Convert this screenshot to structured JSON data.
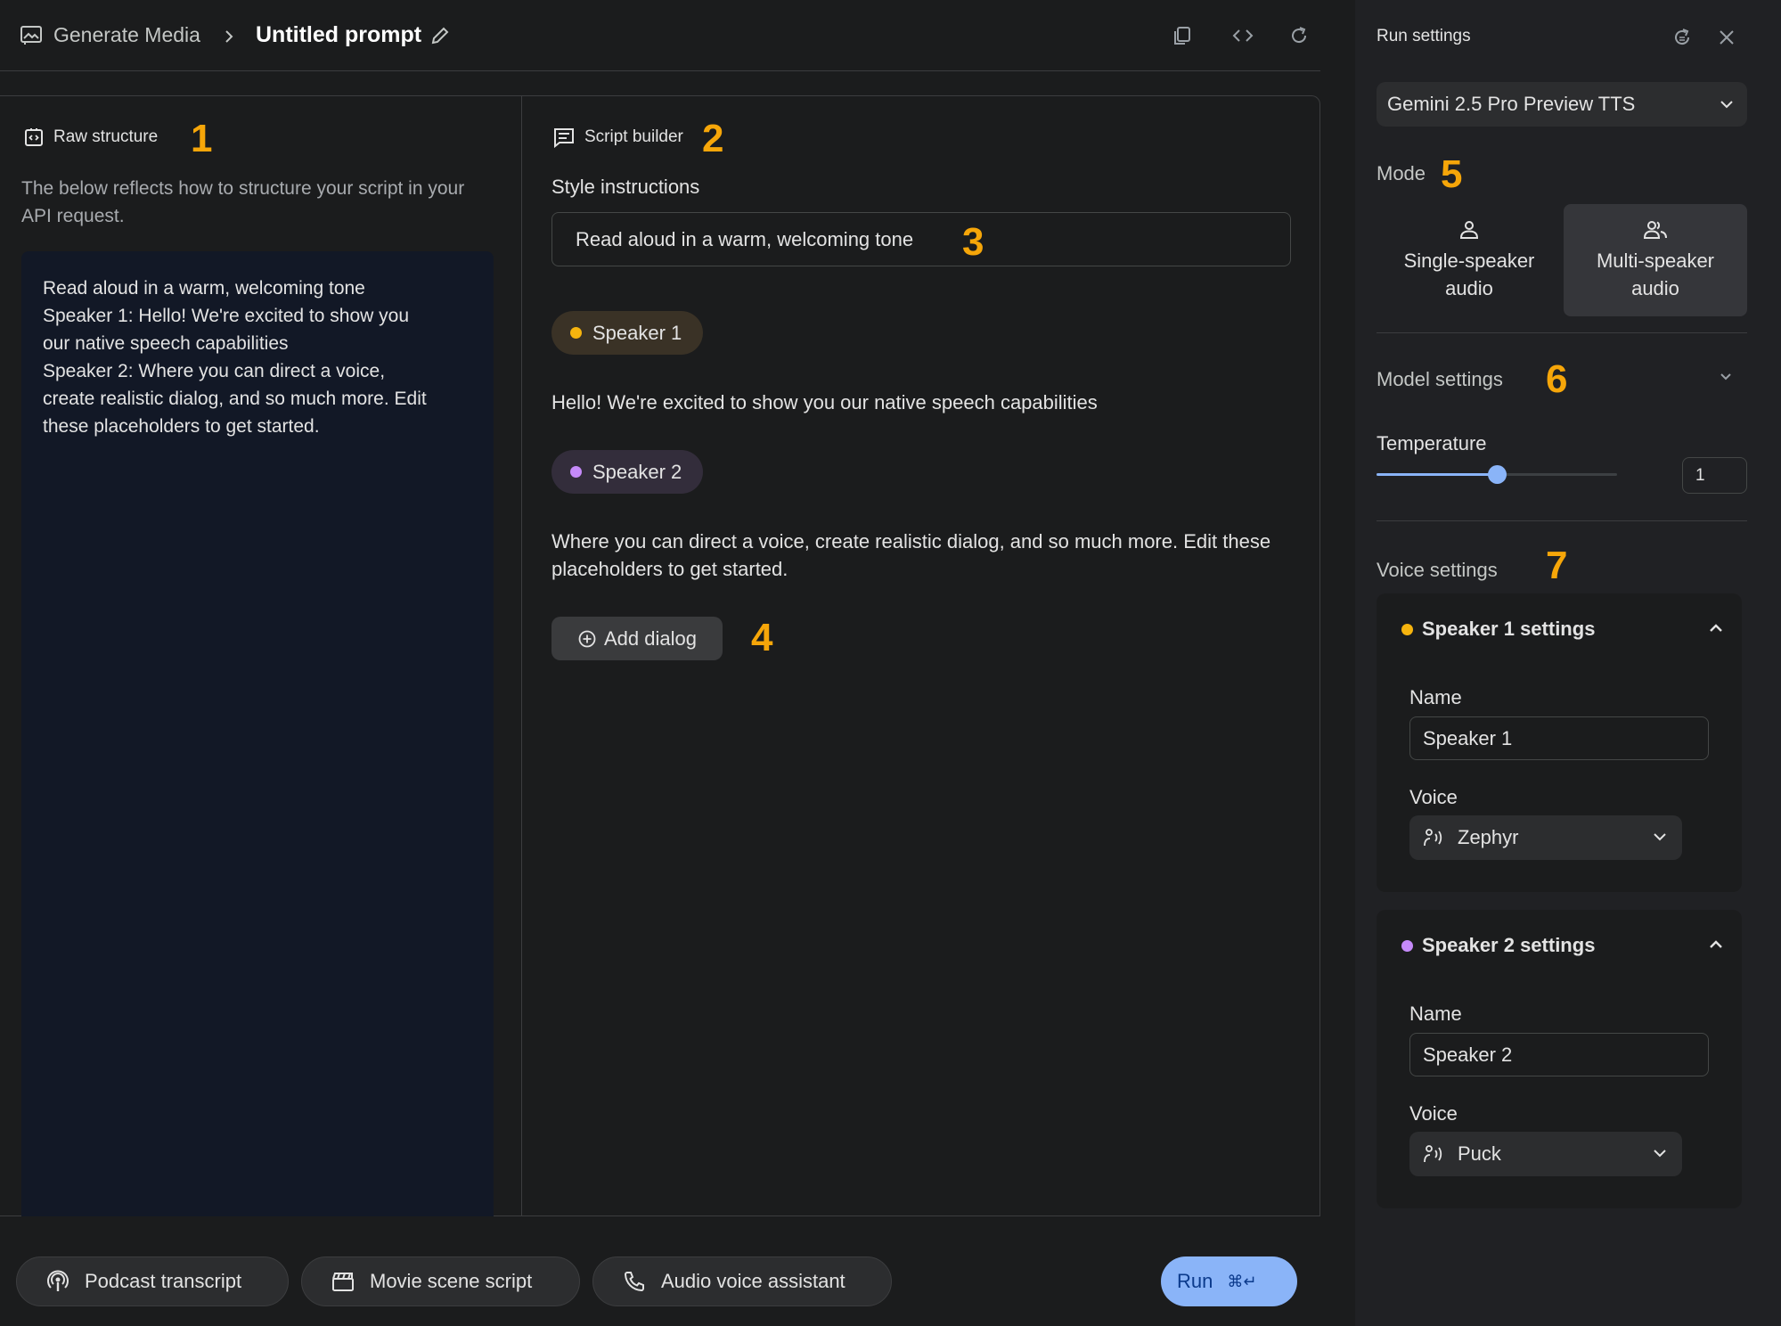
{
  "topbar": {
    "breadcrumb_root": "Generate Media",
    "breadcrumb_current": "Untitled prompt"
  },
  "raw": {
    "title": "Raw structure",
    "description": "The below reflects how to structure your script in your API request.",
    "lines": [
      "Read aloud in a warm, welcoming tone",
      "Speaker 1: Hello! We're excited to show you",
      "our native speech capabilities",
      "Speaker 2: Where you can direct a voice,",
      "create realistic dialog, and so much more. Edit",
      "these placeholders to get started."
    ]
  },
  "builder": {
    "title": "Script builder",
    "style_label": "Style instructions",
    "style_value": "Read aloud in a warm, welcoming tone",
    "speaker1_chip": "Speaker 1",
    "speaker1_text": "Hello! We're excited to show you our native speech capabilities",
    "speaker2_chip": "Speaker 2",
    "speaker2_text": "Where you can direct a voice, create realistic dialog, and so much more. Edit these placeholders to get started.",
    "add_dialog": "Add dialog"
  },
  "markers": [
    "1",
    "2",
    "3",
    "4",
    "5",
    "6",
    "7"
  ],
  "bottom": {
    "podcast": "Podcast transcript",
    "movie": "Movie scene script",
    "assistant": "Audio voice assistant",
    "run": "Run",
    "run_shortcut": "⌘↵"
  },
  "run_settings": {
    "title": "Run settings",
    "model": "Gemini 2.5 Pro Preview TTS",
    "mode_label": "Mode",
    "mode_single_line1": "Single-speaker",
    "mode_single_line2": "audio",
    "mode_multi_line1": "Multi-speaker",
    "mode_multi_line2": "audio",
    "selected_mode": "multi",
    "model_settings_label": "Model settings",
    "temperature_label": "Temperature",
    "temperature_value": "1",
    "temperature_fraction": 0.5,
    "voice_settings_label": "Voice settings",
    "speakers": [
      {
        "header": "Speaker 1 settings",
        "name_label": "Name",
        "name": "Speaker 1",
        "voice_label": "Voice",
        "voice": "Zephyr",
        "color": "#f6b40e"
      },
      {
        "header": "Speaker 2 settings",
        "name_label": "Name",
        "name": "Speaker 2",
        "voice_label": "Voice",
        "voice": "Puck",
        "color": "#c58af9"
      }
    ]
  },
  "colors": {
    "accent": "#8ab4f8",
    "marker": "#f6a609",
    "speaker1": "#f6b40e",
    "speaker2": "#c58af9"
  }
}
